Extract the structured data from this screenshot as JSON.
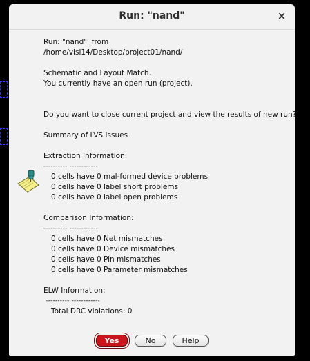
{
  "window": {
    "title": "Run: \"nand\"",
    "close_glyph": "×"
  },
  "message": {
    "run_line": "Run: \"nand\"  from",
    "path": "/home/vlsi14/Desktop/project01/nand/",
    "match_line": "Schematic and Layout Match.",
    "open_run_line": "You currently have an open run (project).",
    "question": "Do you want to close current project and view the results of new run?",
    "summary_heading": "Summary of LVS Issues",
    "extraction": {
      "heading": "Extraction Information:",
      "separator": "---------- ------------",
      "items": [
        "0 cells have 0 mal-formed device problems",
        "0 cells have 0 label short problems",
        "0 cells have 0 label open problems"
      ]
    },
    "comparison": {
      "heading": "Comparison Information:",
      "separator": "---------- ------------",
      "items": [
        "0 cells have 0 Net mismatches",
        "0 cells have 0 Device mismatches",
        "0 cells have 0 Pin mismatches",
        "0 cells have 0 Parameter mismatches"
      ]
    },
    "elw": {
      "heading": "ELW Information:",
      "separator": " ---------- ------------",
      "items": [
        "Total DRC violations: 0"
      ]
    }
  },
  "buttons": {
    "yes": "Yes",
    "no_prefix": "N",
    "no_rest": "o",
    "help_prefix": "H",
    "help_rest": "elp"
  },
  "icons": {
    "note": "pinned-note-icon",
    "close": "close-icon"
  },
  "colors": {
    "dialog_bg": "#f2f2f2",
    "default_button": "#c9161d"
  }
}
